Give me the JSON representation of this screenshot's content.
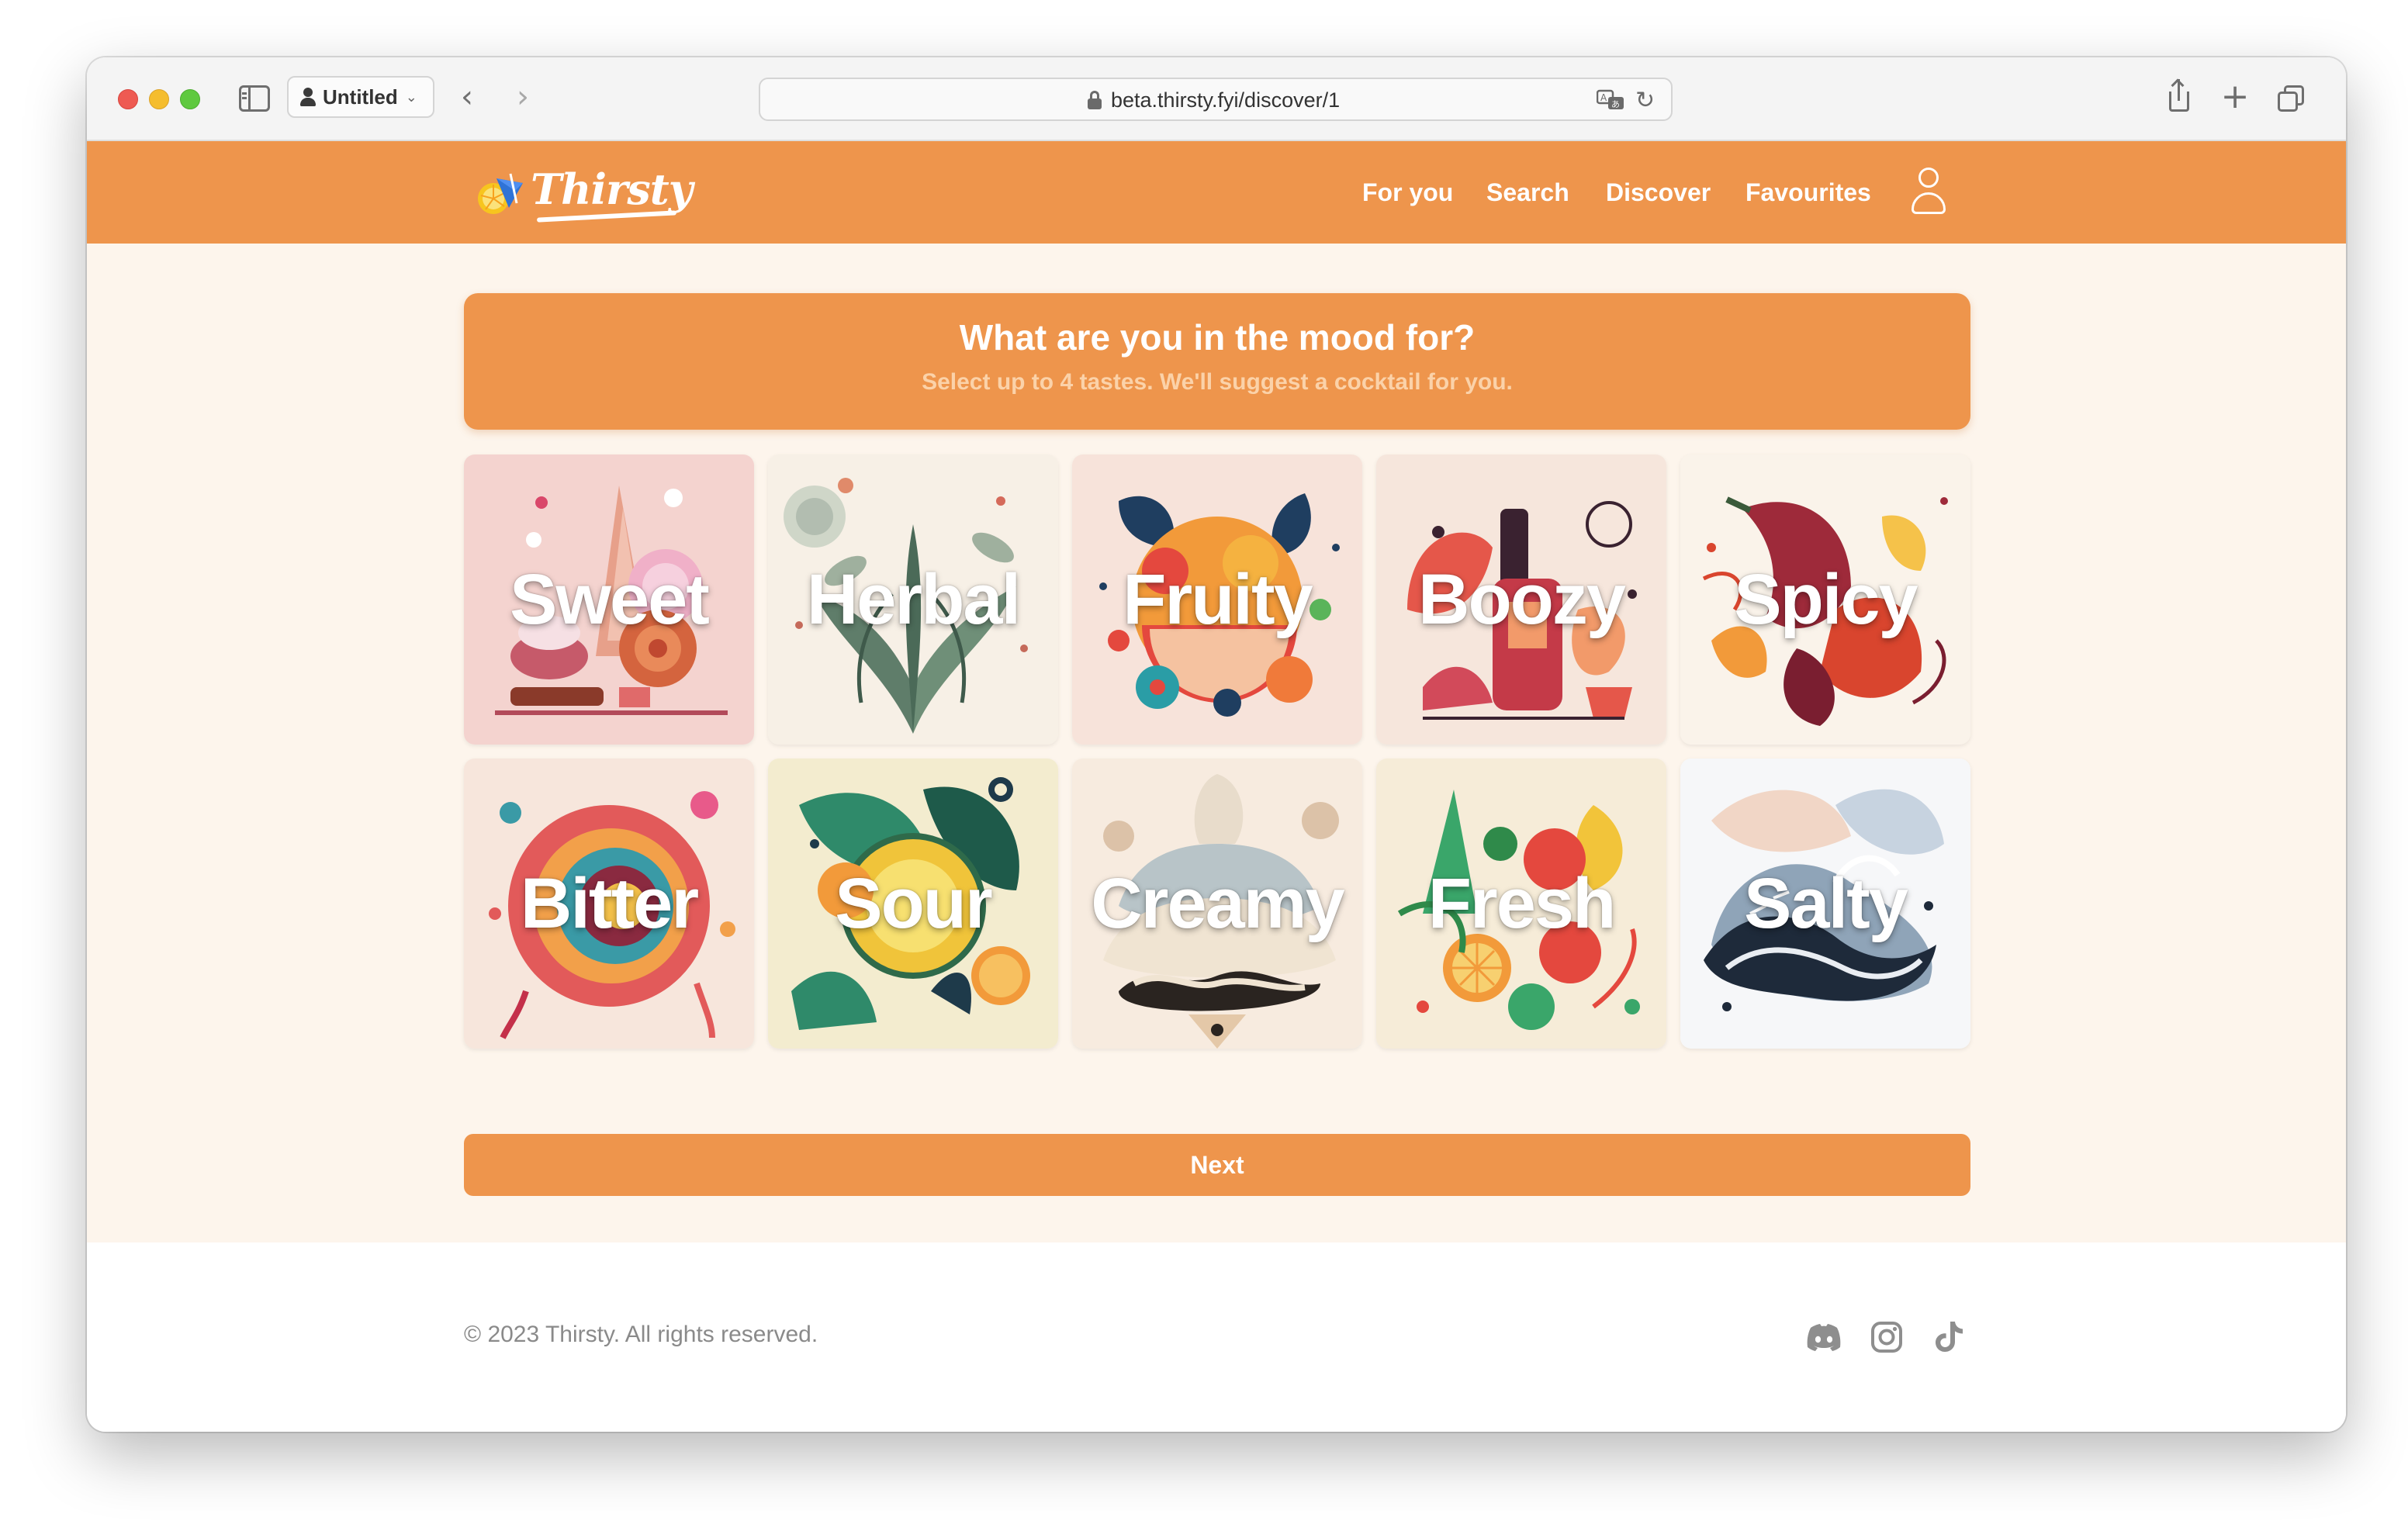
{
  "browser": {
    "profile_label": "Untitled",
    "url": "beta.thirsty.fyi/discover/1"
  },
  "header": {
    "logo_text": "Thirsty",
    "nav": [
      {
        "label": "For you"
      },
      {
        "label": "Search"
      },
      {
        "label": "Discover"
      },
      {
        "label": "Favourites"
      }
    ]
  },
  "banner": {
    "title": "What are you in the mood for?",
    "subtitle": "Select up to 4 tastes. We'll suggest a cocktail for you."
  },
  "tastes": [
    {
      "label": "Sweet"
    },
    {
      "label": "Herbal"
    },
    {
      "label": "Fruity"
    },
    {
      "label": "Boozy"
    },
    {
      "label": "Spicy"
    },
    {
      "label": "Bitter"
    },
    {
      "label": "Sour"
    },
    {
      "label": "Creamy"
    },
    {
      "label": "Fresh"
    },
    {
      "label": "Salty"
    }
  ],
  "next_label": "Next",
  "footer": {
    "copyright": "© 2023 Thirsty. All rights reserved.",
    "social": [
      "discord-icon",
      "instagram-icon",
      "tiktok-icon"
    ]
  },
  "colors": {
    "brand_orange": "#ee954c",
    "page_bg": "#fdf5ec",
    "subtitle": "#fbd2a9"
  }
}
